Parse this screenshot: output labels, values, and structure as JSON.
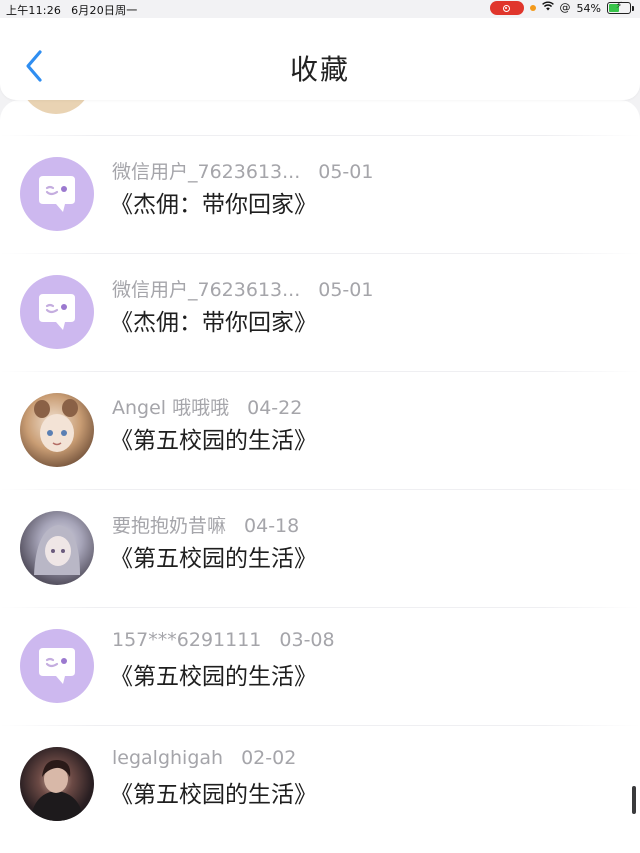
{
  "status_bar": {
    "time": "上午11:26",
    "date": "6月20日周一",
    "battery_percent": "54%",
    "battery_level": 0.54,
    "wifi_icon": "wifi-icon",
    "location_icon": "at-icon"
  },
  "header": {
    "back_icon": "chevron-left-icon",
    "title": "收藏"
  },
  "colors": {
    "accent": "#2f8ef1",
    "default_avatar": "#cdb8ef",
    "meta_text": "#a5a5aa",
    "title_text": "#1f1f1f",
    "record_indicator": "#e0362c",
    "battery": "#38c44a"
  },
  "favorites": [
    {
      "user": "微信用户_7623613...",
      "date": "05-01",
      "title": "《杰佣：带你回家》",
      "avatar": "default-chat-avatar"
    },
    {
      "user": "微信用户_7623613...",
      "date": "05-01",
      "title": "《杰佣：带你回家》",
      "avatar": "default-chat-avatar"
    },
    {
      "user": "Angel 哦哦哦",
      "date": "04-22",
      "title": "《第五校园的生活》",
      "avatar": "anime-bear-avatar"
    },
    {
      "user": "要抱抱奶昔嘛",
      "date": "04-18",
      "title": "《第五校园的生活》",
      "avatar": "anime-silver-hair-avatar"
    },
    {
      "user": "157***6291111",
      "date": "03-08",
      "title": "《第五校园的生活》",
      "avatar": "default-chat-avatar"
    },
    {
      "user": "legalghigah",
      "date": "02-02",
      "title": "《第五校园的生活》",
      "avatar": "photo-avatar"
    }
  ]
}
